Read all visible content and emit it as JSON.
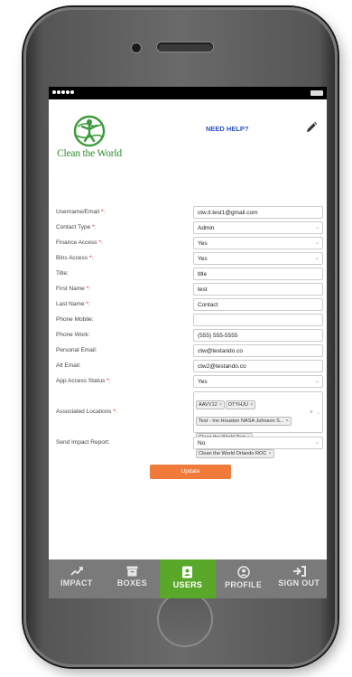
{
  "header": {
    "logo_text": "Clean the World",
    "help_link": "NEED HELP?"
  },
  "form": {
    "rows": [
      {
        "label": "Username/Email",
        "required": "*:",
        "value": "ctw.it.test1@gmail.com",
        "type": "text"
      },
      {
        "label": "Contact Type",
        "required": "*:",
        "value": "Admin",
        "type": "select"
      },
      {
        "label": "Finance Access",
        "required": "*:",
        "value": "Yes",
        "type": "select"
      },
      {
        "label": "Bins Access",
        "required": "*:",
        "value": "Yes",
        "type": "select"
      },
      {
        "label": "Title:",
        "required": "",
        "value": "title",
        "type": "text"
      },
      {
        "label": "First Name",
        "required": "*:",
        "value": "test",
        "type": "text"
      },
      {
        "label": "Last Name",
        "required": "*:",
        "value": "Contact",
        "type": "text"
      },
      {
        "label": "Phone Mobile:",
        "required": "",
        "value": "",
        "type": "text"
      },
      {
        "label": "Phone Work:",
        "required": "",
        "value": "(555) 555-5555",
        "type": "text"
      },
      {
        "label": "Personal Email:",
        "required": "",
        "value": "ctw@testando.co",
        "type": "text"
      },
      {
        "label": "Alt Email:",
        "required": "",
        "value": "ctw2@testando.co",
        "type": "text"
      },
      {
        "label": "App Access Status",
        "required": "*:",
        "value": "Yes",
        "type": "select"
      }
    ],
    "locations": {
      "label": "Associated Locations",
      "required": "*:",
      "tags": [
        "AAVV12",
        "DTYHJU",
        "Test - Inn Houston NASA Johnson S...",
        "Clean the World Test",
        "Clean the World Orlando ROC"
      ],
      "remove_glyph": "×",
      "clear_glyph": "×",
      "caret_glyph": "⌄"
    },
    "impact_report": {
      "label": "Send Impact Report:",
      "value": "No"
    },
    "select_caret": "⌄",
    "update_label": "Update"
  },
  "tabs": [
    {
      "label": "IMPACT",
      "icon": "chart-line-icon",
      "active": false
    },
    {
      "label": "BOXES",
      "icon": "archive-box-icon",
      "active": false
    },
    {
      "label": "USERS",
      "icon": "address-book-icon",
      "active": true
    },
    {
      "label": "PROFILE",
      "icon": "user-circle-icon",
      "active": false
    },
    {
      "label": "SIGN OUT",
      "icon": "sign-out-icon",
      "active": false
    }
  ],
  "colors": {
    "brand_green": "#2f8a2f",
    "active_tab": "#5aa82a",
    "tabbar": "#7a7a7a",
    "update_button": "#f07a3a",
    "help_link": "#2a52be",
    "required": "#dd2222"
  }
}
